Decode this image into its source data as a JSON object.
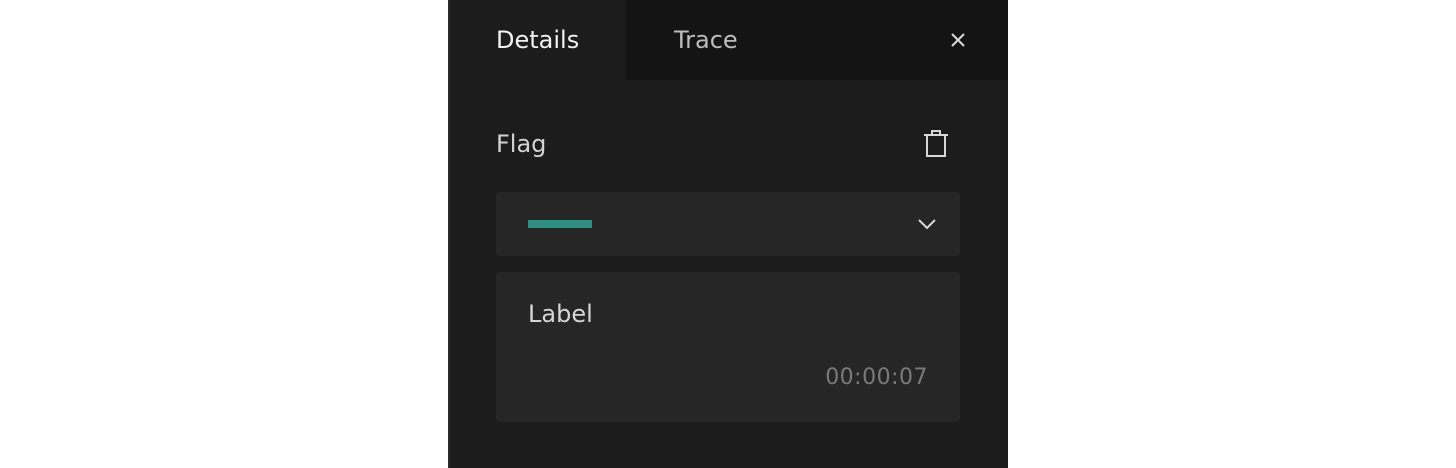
{
  "tabs": {
    "details_label": "Details",
    "trace_label": "Trace",
    "active": "Details"
  },
  "icons": {
    "close": "close-icon",
    "delete": "trash-icon",
    "dropdown": "chevron-down-icon"
  },
  "flag": {
    "title": "Flag",
    "selected_color": "#2e8f84"
  },
  "label_card": {
    "label": "Label",
    "timestamp": "00:00:07"
  },
  "colors": {
    "panel_bg": "#1c1c1c",
    "tabbar_bg": "#141414",
    "field_bg": "#262626",
    "accent": "#2e8f84"
  }
}
